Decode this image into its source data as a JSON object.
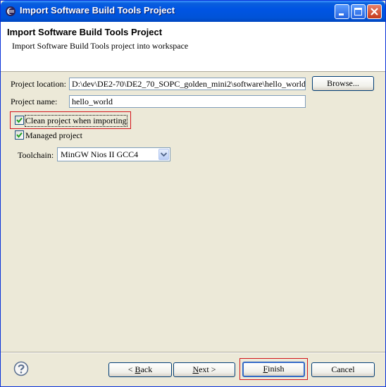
{
  "window": {
    "title": "Import Software Build Tools Project"
  },
  "banner": {
    "title": "Import Software Build Tools Project",
    "description": "Import Software Build Tools project into workspace"
  },
  "form": {
    "project_location": {
      "label": "Project location:",
      "value": "D:\\dev\\DE2-70\\DE2_70_SOPC_golden_mini2\\software\\hello_world",
      "browse_label": "Browse..."
    },
    "project_name": {
      "label": "Project name:",
      "value": "hello_world"
    },
    "clean_project": {
      "label": "Clean project when importing",
      "checked": true
    },
    "managed_project": {
      "label": "Managed project",
      "checked": true
    },
    "toolchain": {
      "label": "Toolchain:",
      "selected": "MinGW Nios II GCC4"
    }
  },
  "buttons": {
    "back_prefix": "< ",
    "back_key": "B",
    "back_rest": "ack",
    "next_key": "N",
    "next_rest": "ext >",
    "finish_key": "F",
    "finish_rest": "inish",
    "cancel": "Cancel"
  },
  "highlight_color": "#d4141b",
  "icons": [
    "eclipse-app-icon",
    "minimize-icon",
    "maximize-icon",
    "close-icon",
    "checkmark-icon",
    "dropdown-arrow-icon",
    "help-icon"
  ]
}
